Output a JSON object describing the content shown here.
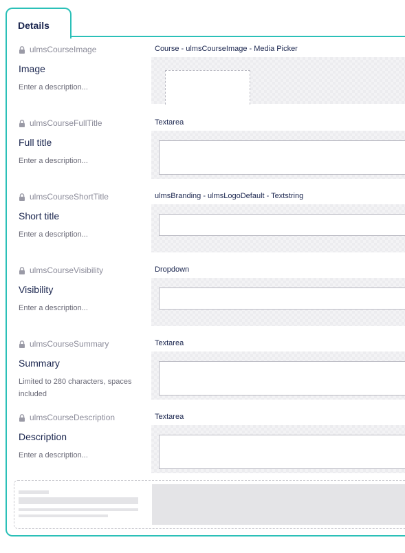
{
  "tab": {
    "label": "Details"
  },
  "properties": [
    {
      "alias": "ulmsCourseImage",
      "label": "Image",
      "description": "Enter a description...",
      "editor": "Course - ulmsCourseImage - Media Picker"
    },
    {
      "alias": "ulmsCourseFullTitle",
      "label": "Full title",
      "description": "Enter a description...",
      "editor": "Textarea"
    },
    {
      "alias": "ulmsCourseShortTitle",
      "label": "Short title",
      "description": "Enter a description...",
      "editor": "ulmsBranding - ulmsLogoDefault - Textstring"
    },
    {
      "alias": "ulmsCourseVisibility",
      "label": "Visibility",
      "description": "Enter a description...",
      "editor": "Dropdown"
    },
    {
      "alias": "ulmsCourseSummary",
      "label": "Summary",
      "description": "Limited to 280 characters, spaces included",
      "editor": "Textarea"
    },
    {
      "alias": "ulmsCourseDescription",
      "label": "Description",
      "description": "Enter a description...",
      "editor": "Textarea"
    }
  ],
  "colors": {
    "accent": "#2bc0b8",
    "text": "#1b264f",
    "muted": "#8c8c9a"
  },
  "icons": {
    "alias_lock": "lock-icon"
  }
}
